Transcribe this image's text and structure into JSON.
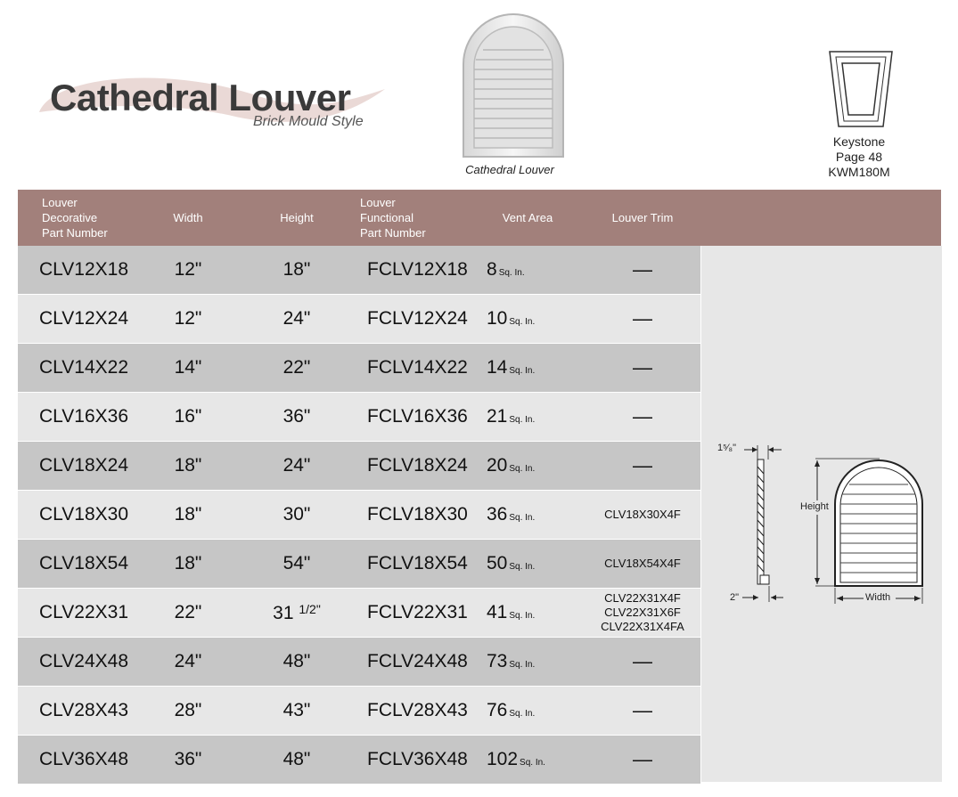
{
  "header": {
    "title": "Cathedral Louver",
    "subtitle": "Brick Mould Style",
    "hero_caption": "Cathedral Louver",
    "keystone": {
      "name": "Keystone",
      "page": "Page 48",
      "part": "KWM180M"
    }
  },
  "table": {
    "columns": [
      [
        "Louver",
        "Decorative",
        "Part Number"
      ],
      [
        "Width"
      ],
      [
        "Height"
      ],
      [
        "Louver",
        "Functional",
        "Part Number"
      ],
      [
        "Vent Area"
      ],
      [
        "Louver Trim"
      ]
    ],
    "unit_label": "Sq. In.",
    "rows": [
      {
        "part": "CLV12X18",
        "width": "12\"",
        "height": "18\"",
        "functional": "FCLV12X18",
        "vent": "8",
        "trim": [
          "—"
        ]
      },
      {
        "part": "CLV12X24",
        "width": "12\"",
        "height": "24\"",
        "functional": "FCLV12X24",
        "vent": "10",
        "trim": [
          "—"
        ]
      },
      {
        "part": "CLV14X22",
        "width": "14\"",
        "height": "22\"",
        "functional": "FCLV14X22",
        "vent": "14",
        "trim": [
          "—"
        ]
      },
      {
        "part": "CLV16X36",
        "width": "16\"",
        "height": "36\"",
        "functional": "FCLV16X36",
        "vent": "21",
        "trim": [
          "—"
        ]
      },
      {
        "part": "CLV18X24",
        "width": "18\"",
        "height": "24\"",
        "functional": "FCLV18X24",
        "vent": "20",
        "trim": [
          "—"
        ]
      },
      {
        "part": "CLV18X30",
        "width": "18\"",
        "height": "30\"",
        "functional": "FCLV18X30",
        "vent": "36",
        "trim": [
          "CLV18X30X4F"
        ]
      },
      {
        "part": "CLV18X54",
        "width": "18\"",
        "height": "54\"",
        "functional": "FCLV18X54",
        "vent": "50",
        "trim": [
          "CLV18X54X4F"
        ]
      },
      {
        "part": "CLV22X31",
        "width": "22\"",
        "height": "31",
        "height_frac": "1/2\"",
        "functional": "FCLV22X31",
        "vent": "41",
        "trim": [
          "CLV22X31X4F",
          "CLV22X31X6F",
          "CLV22X31X4FA"
        ]
      },
      {
        "part": "CLV24X48",
        "width": "24\"",
        "height": "48\"",
        "functional": "FCLV24X48",
        "vent": "73",
        "trim": [
          "—"
        ]
      },
      {
        "part": "CLV28X43",
        "width": "28\"",
        "height": "43\"",
        "functional": "FCLV28X43",
        "vent": "76",
        "trim": [
          "—"
        ]
      },
      {
        "part": "CLV36X48",
        "width": "36\"",
        "height": "48\"",
        "functional": "FCLV36X48",
        "vent": "102",
        "trim": [
          "—"
        ]
      }
    ]
  },
  "diagram": {
    "depth_label": "1⁵⁄₈\"",
    "base_label": "2\"",
    "height_label": "Height",
    "width_label": "Width"
  },
  "colors": {
    "header_bg": "#a2807b",
    "row_dark": "#c6c6c6",
    "row_light": "#e7e7e7"
  }
}
